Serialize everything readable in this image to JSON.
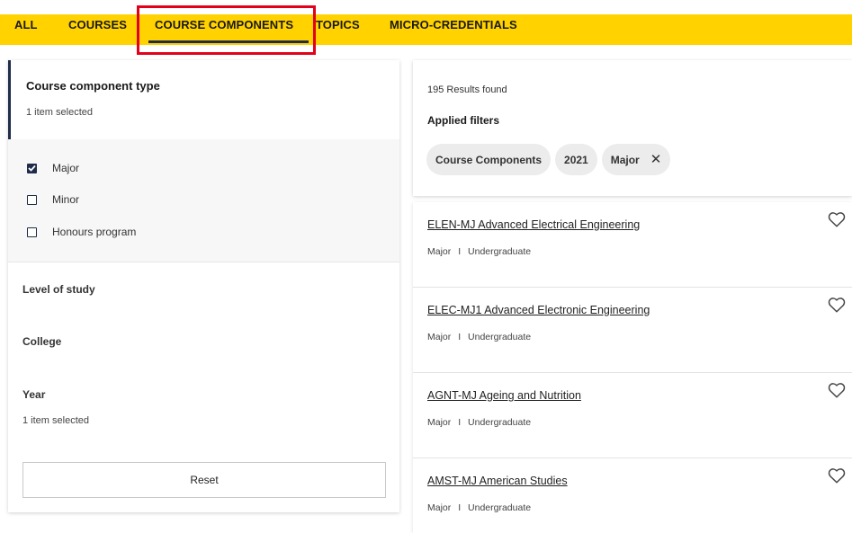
{
  "tabs": [
    {
      "label": "ALL"
    },
    {
      "label": "COURSES"
    },
    {
      "label": "COURSE COMPONENTS",
      "active": true
    },
    {
      "label": "TOPICS"
    },
    {
      "label": "MICRO-CREDENTIALS"
    }
  ],
  "filters": {
    "type_title": "Course component type",
    "type_selected": "1 item selected",
    "options": [
      {
        "label": "Major",
        "checked": true
      },
      {
        "label": "Minor",
        "checked": false
      },
      {
        "label": "Honours program",
        "checked": false
      }
    ],
    "level_label": "Level of study",
    "college_label": "College",
    "year_label": "Year",
    "year_selected": "1 item selected",
    "reset_label": "Reset"
  },
  "results": {
    "count": "195 Results found",
    "applied_label": "Applied filters",
    "chips": [
      "Course Components",
      "2021",
      "Major"
    ],
    "chip_close": "✕",
    "items": [
      {
        "title": "ELEN-MJ Advanced Electrical Engineering",
        "type": "Major",
        "level": "Undergraduate"
      },
      {
        "title": "ELEC-MJ1 Advanced Electronic Engineering",
        "type": "Major",
        "level": "Undergraduate"
      },
      {
        "title": "AGNT-MJ Ageing and Nutrition",
        "type": "Major",
        "level": "Undergraduate"
      },
      {
        "title": "AMST-MJ American Studies",
        "type": "Major",
        "level": "Undergraduate"
      }
    ],
    "separator": "I"
  },
  "colors": {
    "tab_bar": "#ffd200",
    "accent": "#1f2d4a",
    "highlight": "#e3001b"
  }
}
